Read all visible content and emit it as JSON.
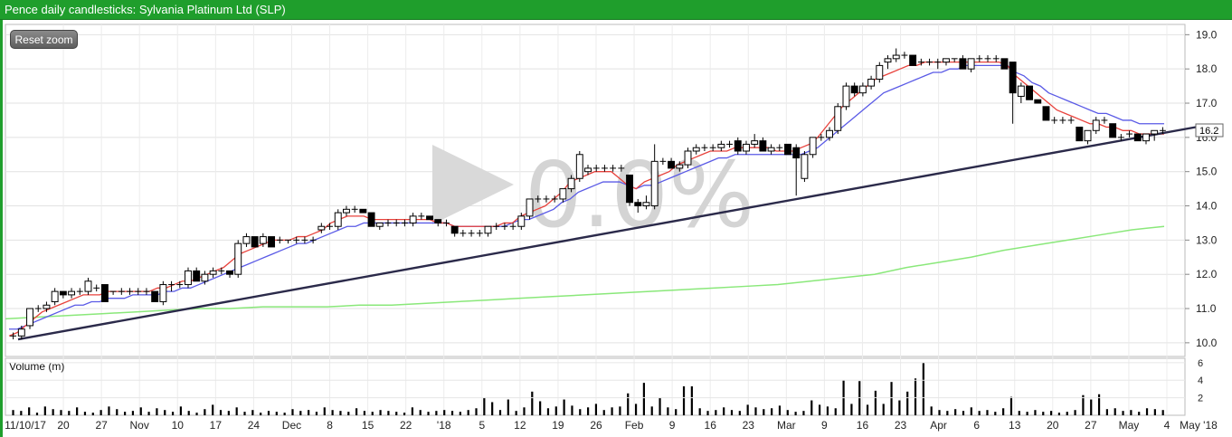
{
  "header": {
    "title": "Pence daily candlesticks: Sylvania Platinum Ltd (SLP)"
  },
  "toolbar": {
    "reset_zoom_label": "Reset zoom"
  },
  "watermark": {
    "text": "0.0%"
  },
  "chart_data": {
    "type": "candlestick",
    "title": "Pence daily candlesticks: Sylvania Platinum Ltd (SLP)",
    "ylim": [
      9.6,
      19.3
    ],
    "yticks": [
      "10.0",
      "11.0",
      "12.0",
      "13.0",
      "14.0",
      "15.0",
      "16.0",
      "17.0",
      "18.0",
      "19.0"
    ],
    "last_price_label": "16.2",
    "x_tick_labels": [
      "11/10/17",
      "20",
      "27",
      "Nov",
      "10",
      "17",
      "24",
      "Dec",
      "8",
      "15",
      "22",
      "'18",
      "5",
      "12",
      "19",
      "26",
      "Feb",
      "9",
      "16",
      "23",
      "Mar",
      "9",
      "16",
      "23",
      "Apr",
      "6",
      "13",
      "20",
      "27",
      "May",
      "4",
      "May '18"
    ],
    "series_colors": {
      "ma_short": "#e8423c",
      "ma_mid": "#5a5ae6",
      "ma_long": "#8ae87a",
      "trendline": "#2b2a4a"
    },
    "candles": [
      [
        10.2,
        10.3,
        10.1,
        10.2
      ],
      [
        10.2,
        10.5,
        10.1,
        10.4
      ],
      [
        10.5,
        11.0,
        10.4,
        11.0
      ],
      [
        11.0,
        11.1,
        10.9,
        11.0
      ],
      [
        11.0,
        11.2,
        10.9,
        11.1
      ],
      [
        11.2,
        11.6,
        11.1,
        11.5
      ],
      [
        11.5,
        11.5,
        11.3,
        11.4
      ],
      [
        11.4,
        11.6,
        11.3,
        11.5
      ],
      [
        11.5,
        11.6,
        11.4,
        11.5
      ],
      [
        11.5,
        11.9,
        11.4,
        11.8
      ],
      [
        11.6,
        11.7,
        11.5,
        11.6
      ],
      [
        11.7,
        11.7,
        11.2,
        11.2
      ],
      [
        11.5,
        11.5,
        11.4,
        11.5
      ],
      [
        11.5,
        11.6,
        11.4,
        11.5
      ],
      [
        11.5,
        11.6,
        11.4,
        11.5
      ],
      [
        11.5,
        11.6,
        11.4,
        11.5
      ],
      [
        11.5,
        11.6,
        11.4,
        11.5
      ],
      [
        11.5,
        11.5,
        11.2,
        11.2
      ],
      [
        11.2,
        11.8,
        11.1,
        11.7
      ],
      [
        11.7,
        11.8,
        11.5,
        11.7
      ],
      [
        11.7,
        11.8,
        11.6,
        11.7
      ],
      [
        11.7,
        12.2,
        11.6,
        12.1
      ],
      [
        12.1,
        12.2,
        11.8,
        11.8
      ],
      [
        11.8,
        12.1,
        11.7,
        12.0
      ],
      [
        12.0,
        12.2,
        11.9,
        12.1
      ],
      [
        12.1,
        12.2,
        12.0,
        12.1
      ],
      [
        12.1,
        12.1,
        11.9,
        12.0
      ],
      [
        12.0,
        13.0,
        11.9,
        12.9
      ],
      [
        12.9,
        13.2,
        12.8,
        13.1
      ],
      [
        13.1,
        13.1,
        12.8,
        12.8
      ],
      [
        12.9,
        13.2,
        12.8,
        13.1
      ],
      [
        13.1,
        13.1,
        12.8,
        12.8
      ],
      [
        13.0,
        13.1,
        12.9,
        13.0
      ],
      [
        13.0,
        13.0,
        12.9,
        13.0
      ],
      [
        13.0,
        13.1,
        12.9,
        13.0
      ],
      [
        13.0,
        13.1,
        12.9,
        13.0
      ],
      [
        13.0,
        13.1,
        12.9,
        13.0
      ],
      [
        13.3,
        13.5,
        13.2,
        13.4
      ],
      [
        13.4,
        13.5,
        13.3,
        13.4
      ],
      [
        13.4,
        13.9,
        13.3,
        13.8
      ],
      [
        13.8,
        14.0,
        13.7,
        13.9
      ],
      [
        13.9,
        14.0,
        13.8,
        13.9
      ],
      [
        13.9,
        13.9,
        13.8,
        13.8
      ],
      [
        13.8,
        13.8,
        13.4,
        13.4
      ],
      [
        13.4,
        13.5,
        13.3,
        13.5
      ],
      [
        13.5,
        13.6,
        13.4,
        13.5
      ],
      [
        13.5,
        13.6,
        13.4,
        13.5
      ],
      [
        13.5,
        13.6,
        13.4,
        13.5
      ],
      [
        13.5,
        13.8,
        13.4,
        13.7
      ],
      [
        13.7,
        13.8,
        13.6,
        13.7
      ],
      [
        13.7,
        13.7,
        13.6,
        13.6
      ],
      [
        13.6,
        13.6,
        13.4,
        13.5
      ],
      [
        13.5,
        13.6,
        13.4,
        13.5
      ],
      [
        13.4,
        13.4,
        13.1,
        13.2
      ],
      [
        13.2,
        13.3,
        13.1,
        13.2
      ],
      [
        13.2,
        13.3,
        13.1,
        13.2
      ],
      [
        13.2,
        13.3,
        13.1,
        13.2
      ],
      [
        13.2,
        13.4,
        13.1,
        13.4
      ],
      [
        13.4,
        13.5,
        13.3,
        13.4
      ],
      [
        13.4,
        13.5,
        13.3,
        13.4
      ],
      [
        13.4,
        13.5,
        13.3,
        13.4
      ],
      [
        13.4,
        13.8,
        13.3,
        13.7
      ],
      [
        13.7,
        14.2,
        13.6,
        14.2
      ],
      [
        14.2,
        14.3,
        14.1,
        14.2
      ],
      [
        14.2,
        14.3,
        14.1,
        14.2
      ],
      [
        14.2,
        14.3,
        14.1,
        14.2
      ],
      [
        14.2,
        14.5,
        14.1,
        14.5
      ],
      [
        14.5,
        14.9,
        14.4,
        14.8
      ],
      [
        14.8,
        15.6,
        14.7,
        15.5
      ],
      [
        15.0,
        15.2,
        14.9,
        15.1
      ],
      [
        15.1,
        15.2,
        15.0,
        15.1
      ],
      [
        15.1,
        15.2,
        15.0,
        15.1
      ],
      [
        15.1,
        15.2,
        15.0,
        15.1
      ],
      [
        15.1,
        15.2,
        15.0,
        15.1
      ],
      [
        14.9,
        14.9,
        14.0,
        14.1
      ],
      [
        14.1,
        14.2,
        13.8,
        14.0
      ],
      [
        14.0,
        14.3,
        13.9,
        14.1
      ],
      [
        14.0,
        15.8,
        13.9,
        15.3
      ],
      [
        15.3,
        15.4,
        15.2,
        15.3
      ],
      [
        15.3,
        15.4,
        15.1,
        15.1
      ],
      [
        15.1,
        15.3,
        15.0,
        15.2
      ],
      [
        15.2,
        15.7,
        15.1,
        15.6
      ],
      [
        15.6,
        15.8,
        15.5,
        15.7
      ],
      [
        15.7,
        15.8,
        15.6,
        15.7
      ],
      [
        15.7,
        15.8,
        15.6,
        15.7
      ],
      [
        15.7,
        15.9,
        15.6,
        15.8
      ],
      [
        15.8,
        15.9,
        15.7,
        15.8
      ],
      [
        15.9,
        16.0,
        15.5,
        15.6
      ],
      [
        15.6,
        15.9,
        15.5,
        15.8
      ],
      [
        15.8,
        16.1,
        15.7,
        15.9
      ],
      [
        15.9,
        16.0,
        15.6,
        15.6
      ],
      [
        15.6,
        15.8,
        15.5,
        15.7
      ],
      [
        15.7,
        15.8,
        15.6,
        15.7
      ],
      [
        15.8,
        15.8,
        15.5,
        15.5
      ],
      [
        15.7,
        15.8,
        14.3,
        15.4
      ],
      [
        14.8,
        15.6,
        14.7,
        15.5
      ],
      [
        15.5,
        16.0,
        15.4,
        16.0
      ],
      [
        16.0,
        16.1,
        15.9,
        16.0
      ],
      [
        16.0,
        16.3,
        15.9,
        16.2
      ],
      [
        16.2,
        17.0,
        16.1,
        16.9
      ],
      [
        16.9,
        17.6,
        16.8,
        17.5
      ],
      [
        17.5,
        17.6,
        17.2,
        17.3
      ],
      [
        17.3,
        17.6,
        17.2,
        17.5
      ],
      [
        17.5,
        17.8,
        17.4,
        17.7
      ],
      [
        17.7,
        18.2,
        17.6,
        18.1
      ],
      [
        18.2,
        18.4,
        18.0,
        18.3
      ],
      [
        18.3,
        18.6,
        18.2,
        18.4
      ],
      [
        18.4,
        18.5,
        18.3,
        18.4
      ],
      [
        18.4,
        18.4,
        18.1,
        18.1
      ],
      [
        18.2,
        18.3,
        18.1,
        18.2
      ],
      [
        18.2,
        18.3,
        18.1,
        18.2
      ],
      [
        18.2,
        18.3,
        18.0,
        18.2
      ],
      [
        18.2,
        18.3,
        18.1,
        18.3
      ],
      [
        18.3,
        18.3,
        18.2,
        18.3
      ],
      [
        18.3,
        18.4,
        18.0,
        18.0
      ],
      [
        18.0,
        18.3,
        17.9,
        18.3
      ],
      [
        18.3,
        18.4,
        18.2,
        18.3
      ],
      [
        18.3,
        18.4,
        18.2,
        18.3
      ],
      [
        18.3,
        18.4,
        18.2,
        18.3
      ],
      [
        18.3,
        18.3,
        18.0,
        18.0
      ],
      [
        18.2,
        18.2,
        16.4,
        17.3
      ],
      [
        17.2,
        17.6,
        17.0,
        17.5
      ],
      [
        17.5,
        17.5,
        17.1,
        17.1
      ],
      [
        17.1,
        17.1,
        17.0,
        17.0
      ],
      [
        16.9,
        16.9,
        16.5,
        16.5
      ],
      [
        16.5,
        16.6,
        16.4,
        16.5
      ],
      [
        16.5,
        16.6,
        16.4,
        16.5
      ],
      [
        16.5,
        16.6,
        16.4,
        16.5
      ],
      [
        16.3,
        16.3,
        15.9,
        15.9
      ],
      [
        15.9,
        16.2,
        15.8,
        16.2
      ],
      [
        16.2,
        16.6,
        16.1,
        16.5
      ],
      [
        16.5,
        16.6,
        16.4,
        16.5
      ],
      [
        16.4,
        16.4,
        16.0,
        16.0
      ],
      [
        16.0,
        16.1,
        15.9,
        16.0
      ],
      [
        16.1,
        16.2,
        16.0,
        16.1
      ],
      [
        16.1,
        16.1,
        15.9,
        15.9
      ],
      [
        15.9,
        16.1,
        15.8,
        16.1
      ],
      [
        16.1,
        16.2,
        15.9,
        16.2
      ],
      [
        16.2,
        16.3,
        16.1,
        16.2
      ]
    ],
    "ma_short": [
      10.2,
      10.3,
      10.5,
      10.7,
      10.9,
      11.0,
      11.1,
      11.2,
      11.3,
      11.4,
      11.4,
      11.4,
      11.5,
      11.5,
      11.5,
      11.5,
      11.5,
      11.5,
      11.6,
      11.6,
      11.7,
      11.8,
      11.8,
      11.9,
      12.0,
      12.1,
      12.2,
      12.4,
      12.6,
      12.7,
      12.8,
      12.9,
      13.0,
      13.0,
      13.0,
      13.1,
      13.1,
      13.2,
      13.3,
      13.5,
      13.6,
      13.7,
      13.7,
      13.7,
      13.6,
      13.6,
      13.6,
      13.6,
      13.6,
      13.6,
      13.6,
      13.6,
      13.5,
      13.5,
      13.4,
      13.4,
      13.4,
      13.4,
      13.4,
      13.4,
      13.5,
      13.5,
      13.7,
      13.8,
      13.9,
      14.0,
      14.2,
      14.4,
      14.7,
      14.8,
      14.9,
      15.0,
      15.0,
      15.0,
      14.8,
      14.6,
      14.5,
      14.7,
      14.8,
      14.9,
      15.0,
      15.2,
      15.3,
      15.4,
      15.5,
      15.6,
      15.6,
      15.6,
      15.7,
      15.7,
      15.7,
      15.7,
      15.7,
      15.6,
      15.6,
      15.6,
      15.7,
      15.8,
      16.0,
      16.3,
      16.6,
      16.9,
      17.1,
      17.3,
      17.5,
      17.7,
      17.8,
      17.9,
      18.0,
      18.1,
      18.1,
      18.2,
      18.2,
      18.2,
      18.2,
      18.2,
      18.2,
      18.2,
      18.2,
      18.2,
      18.2,
      18.1,
      17.8,
      17.6,
      17.4,
      17.2,
      17.0,
      16.8,
      16.7,
      16.6,
      16.5,
      16.4,
      16.4,
      16.3,
      16.3,
      16.2,
      16.2,
      16.1,
      16.1,
      16.1,
      16.1
    ],
    "ma_mid": [
      10.4,
      10.4,
      10.5,
      10.6,
      10.7,
      10.8,
      10.9,
      11.0,
      11.1,
      11.1,
      11.2,
      11.2,
      11.3,
      11.3,
      11.3,
      11.4,
      11.4,
      11.4,
      11.4,
      11.5,
      11.5,
      11.6,
      11.6,
      11.7,
      11.8,
      11.9,
      12.0,
      12.1,
      12.2,
      12.3,
      12.4,
      12.5,
      12.6,
      12.7,
      12.8,
      12.9,
      12.9,
      13.0,
      13.1,
      13.2,
      13.3,
      13.4,
      13.4,
      13.5,
      13.5,
      13.5,
      13.5,
      13.5,
      13.5,
      13.5,
      13.5,
      13.5,
      13.5,
      13.5,
      13.4,
      13.4,
      13.4,
      13.4,
      13.4,
      13.4,
      13.4,
      13.5,
      13.6,
      13.6,
      13.7,
      13.8,
      13.9,
      14.1,
      14.2,
      14.4,
      14.5,
      14.6,
      14.7,
      14.7,
      14.7,
      14.6,
      14.5,
      14.6,
      14.6,
      14.7,
      14.8,
      14.9,
      15.0,
      15.1,
      15.2,
      15.3,
      15.4,
      15.4,
      15.5,
      15.5,
      15.5,
      15.5,
      15.5,
      15.5,
      15.5,
      15.5,
      15.5,
      15.6,
      15.7,
      15.9,
      16.1,
      16.3,
      16.5,
      16.7,
      16.9,
      17.1,
      17.3,
      17.4,
      17.5,
      17.6,
      17.7,
      17.8,
      17.9,
      17.9,
      18.0,
      18.0,
      18.1,
      18.1,
      18.1,
      18.1,
      18.1,
      18.1,
      17.9,
      17.8,
      17.6,
      17.5,
      17.3,
      17.2,
      17.1,
      17.0,
      16.9,
      16.8,
      16.7,
      16.7,
      16.6,
      16.5,
      16.5,
      16.4,
      16.4,
      16.4,
      16.4
    ],
    "ma_long_start": 10.7,
    "ma_long": [
      10.7,
      10.75,
      10.8,
      10.85,
      10.9,
      10.95,
      11.0,
      11.0,
      11.05,
      11.05,
      11.05,
      11.1,
      11.1,
      11.15,
      11.2,
      11.25,
      11.3,
      11.35,
      11.4,
      11.45,
      11.5,
      11.55,
      11.6,
      11.65,
      11.7,
      11.8,
      11.9,
      12.0,
      12.2,
      12.35,
      12.5,
      12.7,
      12.85,
      13.0,
      13.15,
      13.3,
      13.4
    ],
    "trendline": {
      "start_value": 10.1,
      "end_value": 16.3
    },
    "volume": {
      "label": "Volume (m)",
      "yticks": [
        "2",
        "4",
        "6"
      ],
      "ylim": [
        0,
        6.5
      ],
      "values": [
        0.6,
        0.5,
        0.9,
        0.3,
        1.0,
        0.7,
        0.6,
        0.5,
        0.9,
        0.4,
        0.3,
        0.6,
        1.0,
        0.7,
        0.4,
        0.5,
        0.9,
        0.4,
        0.8,
        0.6,
        0.4,
        1.0,
        0.5,
        0.3,
        0.7,
        1.2,
        0.6,
        0.5,
        0.9,
        0.4,
        0.6,
        0.3,
        0.5,
        0.4,
        0.3,
        0.7,
        0.5,
        0.6,
        0.4,
        0.9,
        0.6,
        0.5,
        0.4,
        0.8,
        0.5,
        0.4,
        0.6,
        0.5,
        0.4,
        0.3,
        0.9,
        0.6,
        0.4,
        0.5,
        0.6,
        0.5,
        0.4,
        0.6,
        0.8,
        2.0,
        1.5,
        0.6,
        1.8,
        0.5,
        0.9,
        2.7,
        1.6,
        0.8,
        1.0,
        1.8,
        1.1,
        0.7,
        0.9,
        1.3,
        0.6,
        0.9,
        1.0,
        2.5,
        1.3,
        3.7,
        1.0,
        2.0,
        0.9,
        0.7,
        3.3,
        3.3,
        0.8,
        0.5,
        0.6,
        0.9,
        0.6,
        0.5,
        1.2,
        0.9,
        0.7,
        0.8,
        1.1,
        0.6,
        0.4,
        0.5,
        1.7,
        1.2,
        1.0,
        0.8,
        4.0,
        1.3,
        3.9,
        1.2,
        2.8,
        1.3,
        3.8,
        1.7,
        2.7,
        4.2,
        6.0,
        1.0,
        0.6,
        0.5,
        0.7,
        0.5,
        0.9,
        0.5,
        0.6,
        0.4,
        0.8,
        2.1,
        0.5,
        0.4,
        0.6,
        0.4,
        0.5,
        0.3,
        0.4,
        0.6,
        2.3,
        1.8,
        2.4,
        0.7,
        0.8,
        0.5,
        0.6,
        0.4,
        0.8,
        0.7,
        0.6
      ]
    }
  }
}
